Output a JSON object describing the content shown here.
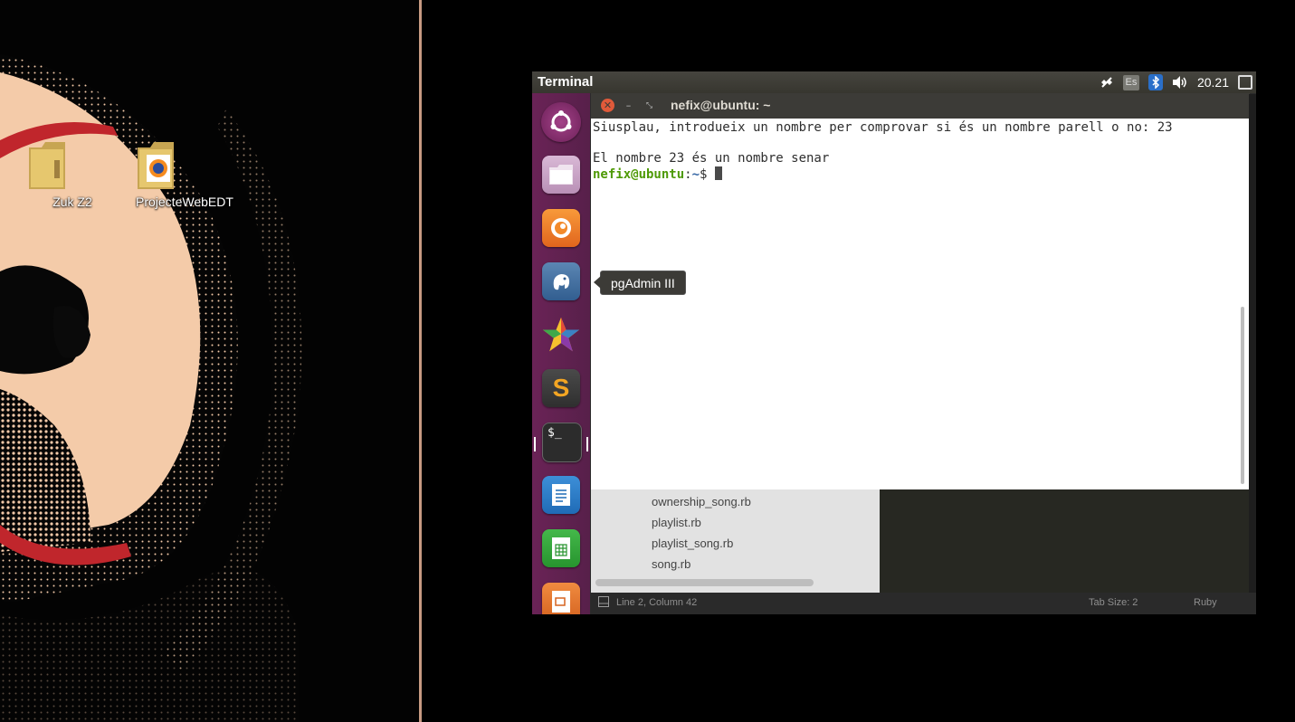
{
  "desktop": {
    "icons": [
      {
        "label": "Zuk Z2",
        "icon": "folder-icon"
      },
      {
        "label": "ProjecteWebEDT",
        "icon": "firefox-folder-icon"
      }
    ]
  },
  "top_panel": {
    "app_title": "Terminal",
    "keyboard_layout": "Es",
    "clock": "20.21"
  },
  "launcher": {
    "items": [
      {
        "name": "ubuntu-dash",
        "icon": "ubuntu-logo-icon"
      },
      {
        "name": "files",
        "icon": "folder-icon"
      },
      {
        "name": "firefox",
        "icon": "firefox-icon"
      },
      {
        "name": "pgadmin",
        "icon": "elephant-icon"
      },
      {
        "name": "starred-app",
        "icon": "star-icon"
      },
      {
        "name": "sublime-text",
        "icon": "sublime-icon"
      },
      {
        "name": "terminal",
        "icon": "terminal-icon"
      },
      {
        "name": "writer",
        "icon": "document-icon"
      },
      {
        "name": "calc",
        "icon": "spreadsheet-icon"
      },
      {
        "name": "impress",
        "icon": "presentation-icon"
      }
    ],
    "tooltip": "pgAdmin III"
  },
  "terminal": {
    "title": "nefix@ubuntu: ~",
    "lines": [
      "Siusplau, introdueix un nombre per comprovar si és un nombre parell o no: 23",
      "",
      "El nombre 23 és un nombre senar"
    ],
    "prompt_user": "nefix@ubuntu",
    "prompt_sep": ":",
    "prompt_path": "~",
    "prompt_symbol": "$ "
  },
  "editor": {
    "files": [
      "ownership_song.rb",
      "playlist.rb",
      "playlist_song.rb",
      "song.rb"
    ],
    "status": {
      "position": "Line 2, Column 42",
      "tab_size": "Tab Size: 2",
      "syntax": "Ruby"
    }
  },
  "colors": {
    "launcher_bg": "#5d1f4b",
    "panel_bg": "#3c3b37",
    "prompt_user": "#4e9a06",
    "prompt_path": "#3465a4",
    "close_button": "#e05a3a"
  }
}
